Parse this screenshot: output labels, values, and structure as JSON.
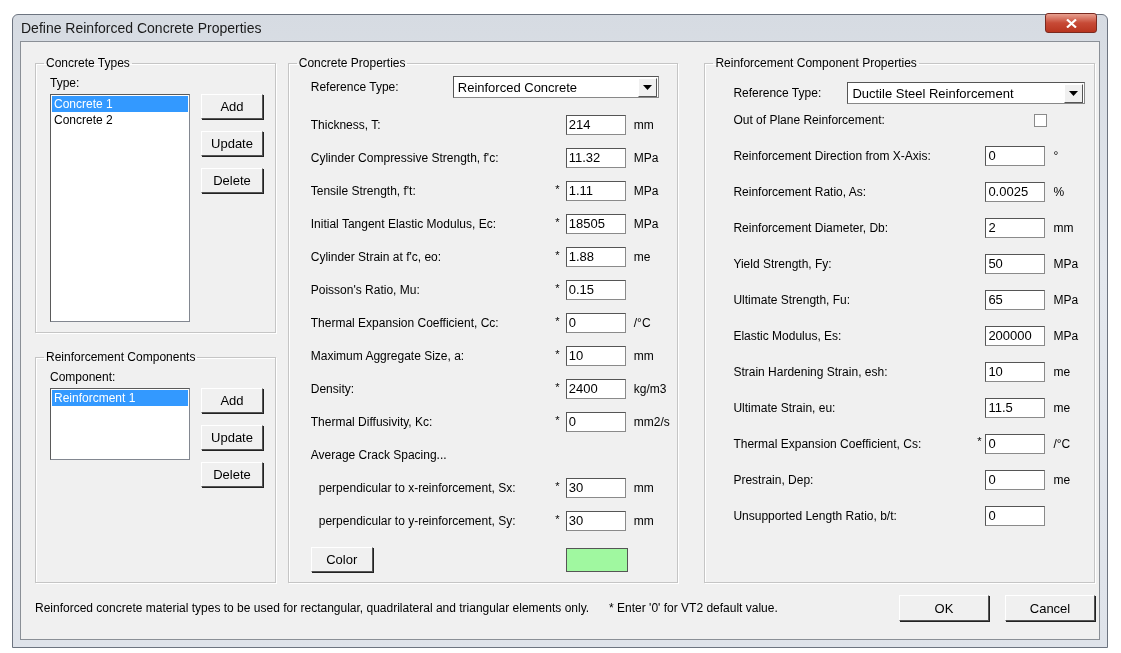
{
  "window": {
    "title": "Define Reinforced Concrete Properties"
  },
  "concrete_types": {
    "title": "Concrete Types",
    "list_label": "Type:",
    "items": [
      {
        "label": "Concrete 1",
        "selected": true
      },
      {
        "label": "Concrete 2",
        "selected": false
      }
    ],
    "buttons": [
      "Add",
      "Update",
      "Delete"
    ]
  },
  "reinforcement_components": {
    "title": "Reinforcement Components",
    "list_label": "Component:",
    "items": [
      {
        "label": "Reinforcment 1",
        "selected": true
      }
    ],
    "buttons": [
      "Add",
      "Update",
      "Delete"
    ]
  },
  "concrete_properties": {
    "title": "Concrete Properties",
    "reference_type": {
      "label": "Reference Type:",
      "value": "Reinforced Concrete"
    },
    "rows": [
      {
        "label": "Thickness, T:",
        "value": "214",
        "unit": "mm"
      },
      {
        "label": "Cylinder Compressive Strength, f'c:",
        "value": "11.32",
        "unit": "MPa"
      },
      {
        "label": "Tensile Strength, f't:",
        "note": "*",
        "value": "1.11",
        "unit": "MPa"
      },
      {
        "label": "Initial Tangent Elastic Modulus, Ec:",
        "note": "*",
        "value": "18505",
        "unit": "MPa"
      },
      {
        "label": "Cylinder Strain at f'c, eo:",
        "note": "*",
        "value": "1.88",
        "unit": "me"
      },
      {
        "label": "Poisson's Ratio, Mu:",
        "note": "*",
        "value": "0.15"
      },
      {
        "label": "Thermal Expansion Coefficient, Cc:",
        "note": "*",
        "value": "0",
        "unit": "/°C"
      },
      {
        "label": "Maximum Aggregate Size, a:",
        "note": "*",
        "value": "10",
        "unit": "mm"
      },
      {
        "label": "Density:",
        "note": "*",
        "value": "2400",
        "unit": "kg/m3"
      },
      {
        "label": "Thermal Diffusivity, Kc:",
        "note": "*",
        "value": "0",
        "unit": "mm2/s"
      },
      {
        "label": "Average Crack Spacing...",
        "children": [
          {
            "label": "perpendicular to x-reinforcement, Sx:",
            "note": "*",
            "value": "30",
            "unit": "mm"
          },
          {
            "label": "perpendicular to y-reinforcement, Sy:",
            "note": "*",
            "value": "30",
            "unit": "mm"
          }
        ]
      }
    ],
    "color_button": {
      "label": "Color",
      "color": "#a0f8a0"
    }
  },
  "reinforcement_properties": {
    "title": "Reinforcement Component Properties",
    "reference_type": {
      "label": "Reference Type:",
      "value": "Ductile Steel Reinforcement"
    },
    "out_of_plane": {
      "label": "Out of Plane Reinforcement:",
      "checked": false
    },
    "rows": [
      {
        "label": "Reinforcement Direction from X-Axis:",
        "value": "0",
        "unit": "°"
      },
      {
        "label": "Reinforcement Ratio, As:",
        "value": "0.0025",
        "unit": "%"
      },
      {
        "label": "Reinforcement Diameter, Db:",
        "value": "2",
        "unit": "mm"
      },
      {
        "label": "Yield Strength, Fy:",
        "value": "50",
        "unit": "MPa"
      },
      {
        "label": "Ultimate Strength, Fu:",
        "value": "65",
        "unit": "MPa"
      },
      {
        "label": "Elastic Modulus, Es:",
        "value": "200000",
        "unit": "MPa"
      },
      {
        "label": "Strain Hardening Strain, esh:",
        "value": "10",
        "unit": "me"
      },
      {
        "label": "Ultimate Strain, eu:",
        "value": "11.5",
        "unit": "me"
      },
      {
        "label": "Thermal Expansion Coefficient, Cs:",
        "note": "*",
        "value": "0",
        "unit": "/°C"
      },
      {
        "label": "Prestrain, Dep:",
        "value": "0",
        "unit": "me"
      },
      {
        "label": "Unsupported Length Ratio, b/t:",
        "value": "0"
      }
    ]
  },
  "footer": {
    "note": "Reinforced concrete material types to be used for rectangular, quadrilateral and triangular elements only.",
    "default_note": "* Enter '0' for VT2 default value.",
    "buttons": [
      "OK",
      "Cancel"
    ]
  }
}
